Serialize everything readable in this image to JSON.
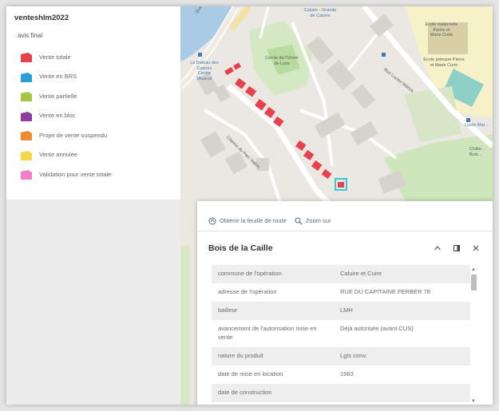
{
  "legend": {
    "title": "venteshlm2022",
    "subtitle": "avis final",
    "items": [
      {
        "label": "Vente totale",
        "color": "#e8414e"
      },
      {
        "label": "Vente en BRS",
        "color": "#2b9ed4"
      },
      {
        "label": "Vente partielle",
        "color": "#a3c644"
      },
      {
        "label": "Vente en bloc",
        "color": "#8e3d9e"
      },
      {
        "label": "Projet de vente suspendu",
        "color": "#f08a2e"
      },
      {
        "label": "Vente annulée",
        "color": "#f7d64a"
      },
      {
        "label": "Validation pour vente totale",
        "color": "#f07fc8"
      }
    ]
  },
  "map": {
    "labels": {
      "street_top": "Quai Clé",
      "caluire": "Caluire - Grande\nde Caluire",
      "ecole_maternelle": "Ecole maternelle\nPierre et\nMarie Curie",
      "centre_lyon": "Cercle de l'Union\nde Lyon",
      "ecole_primaire": "Ecole primaire Pierre\net Marie Curie",
      "bateau": "Le Bateau des\nCastors\nCentre\nMusical",
      "rue_leclerc": "Rue Lucien Mâhus",
      "chemin": "Chemin du Parc Vallon",
      "lycee": "Lycée Mar...",
      "chateau": "Châte...\nBois..."
    }
  },
  "popup": {
    "actions": {
      "route": "Obtenir la feuille de route",
      "zoom": "Zoom sur"
    },
    "title": "Bois de la Caille",
    "rows": [
      {
        "key": "commune de l'opération",
        "value": "Caluire et Cuire"
      },
      {
        "key": "adresse de l'opération",
        "value": "RUE DU CAPITAINE FERBER 78"
      },
      {
        "key": "bailleur",
        "value": "LMH"
      },
      {
        "key": "avancement de l'autorisation mise en vente",
        "value": "Déjà autorisée (avant CUS)"
      },
      {
        "key": "nature du produit",
        "value": "Lgts conv."
      },
      {
        "key": "date de mise en location",
        "value": "1983"
      },
      {
        "key": "date de construction",
        "value": ""
      }
    ]
  }
}
